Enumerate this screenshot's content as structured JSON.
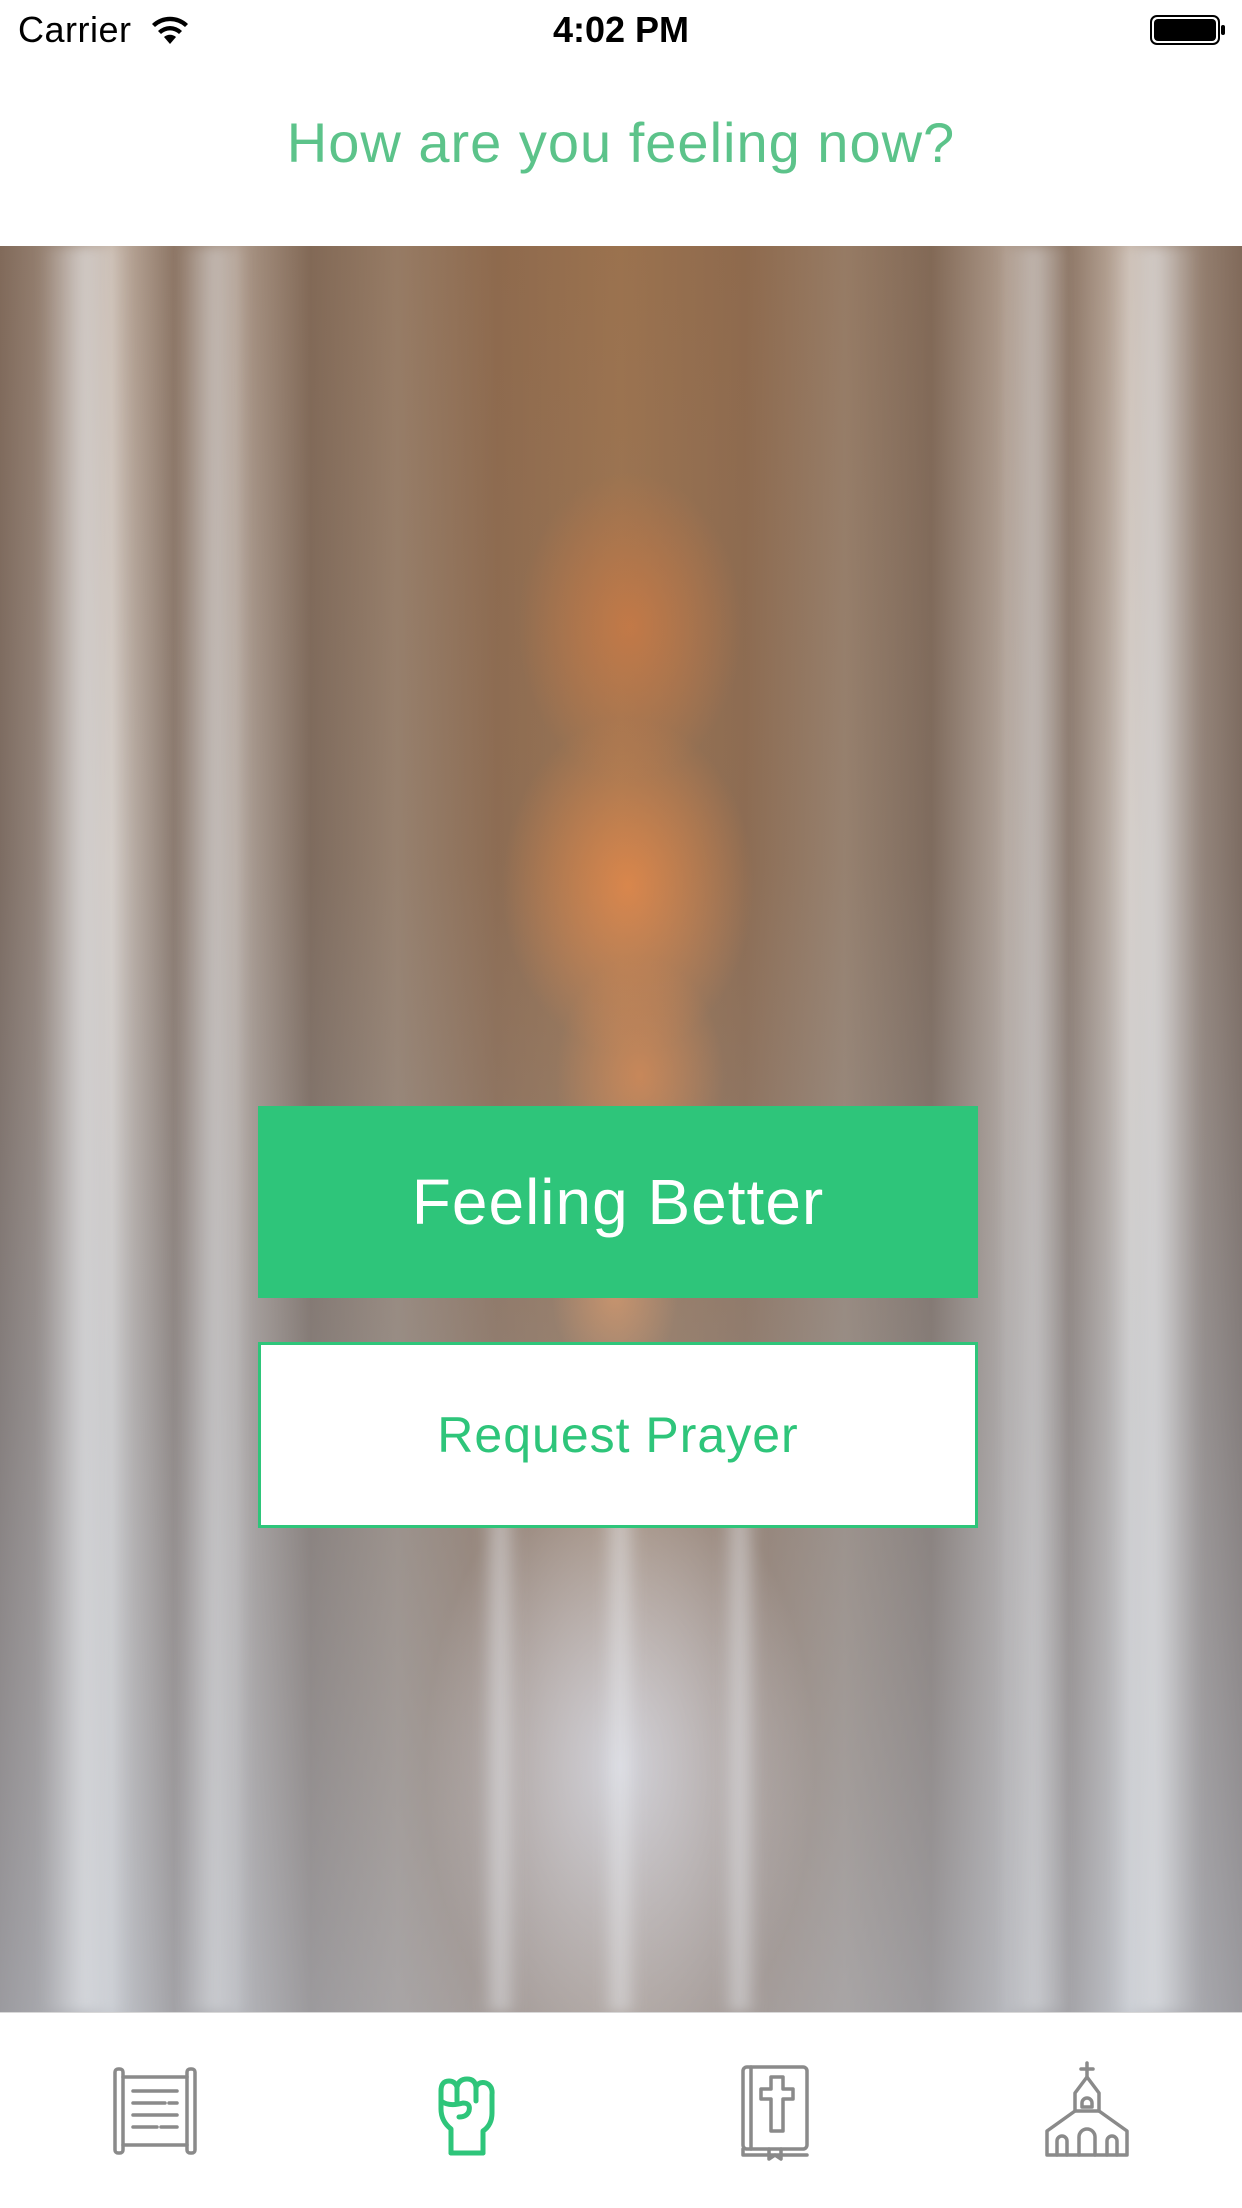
{
  "status_bar": {
    "carrier": "Carrier",
    "time": "4:02 PM"
  },
  "header": {
    "title": "How are you feeling now?"
  },
  "actions": {
    "primary_label": "Feeling Better",
    "secondary_label": "Request Prayer"
  },
  "tab_bar": {
    "tabs": [
      {
        "icon": "scroll-icon",
        "active": false
      },
      {
        "icon": "raised-fist-icon",
        "active": true
      },
      {
        "icon": "bible-icon",
        "active": false
      },
      {
        "icon": "church-icon",
        "active": false
      }
    ]
  },
  "colors": {
    "accent": "#2ec57a",
    "header_text": "#5cc38a",
    "inactive_icon": "#8a8a8a"
  }
}
